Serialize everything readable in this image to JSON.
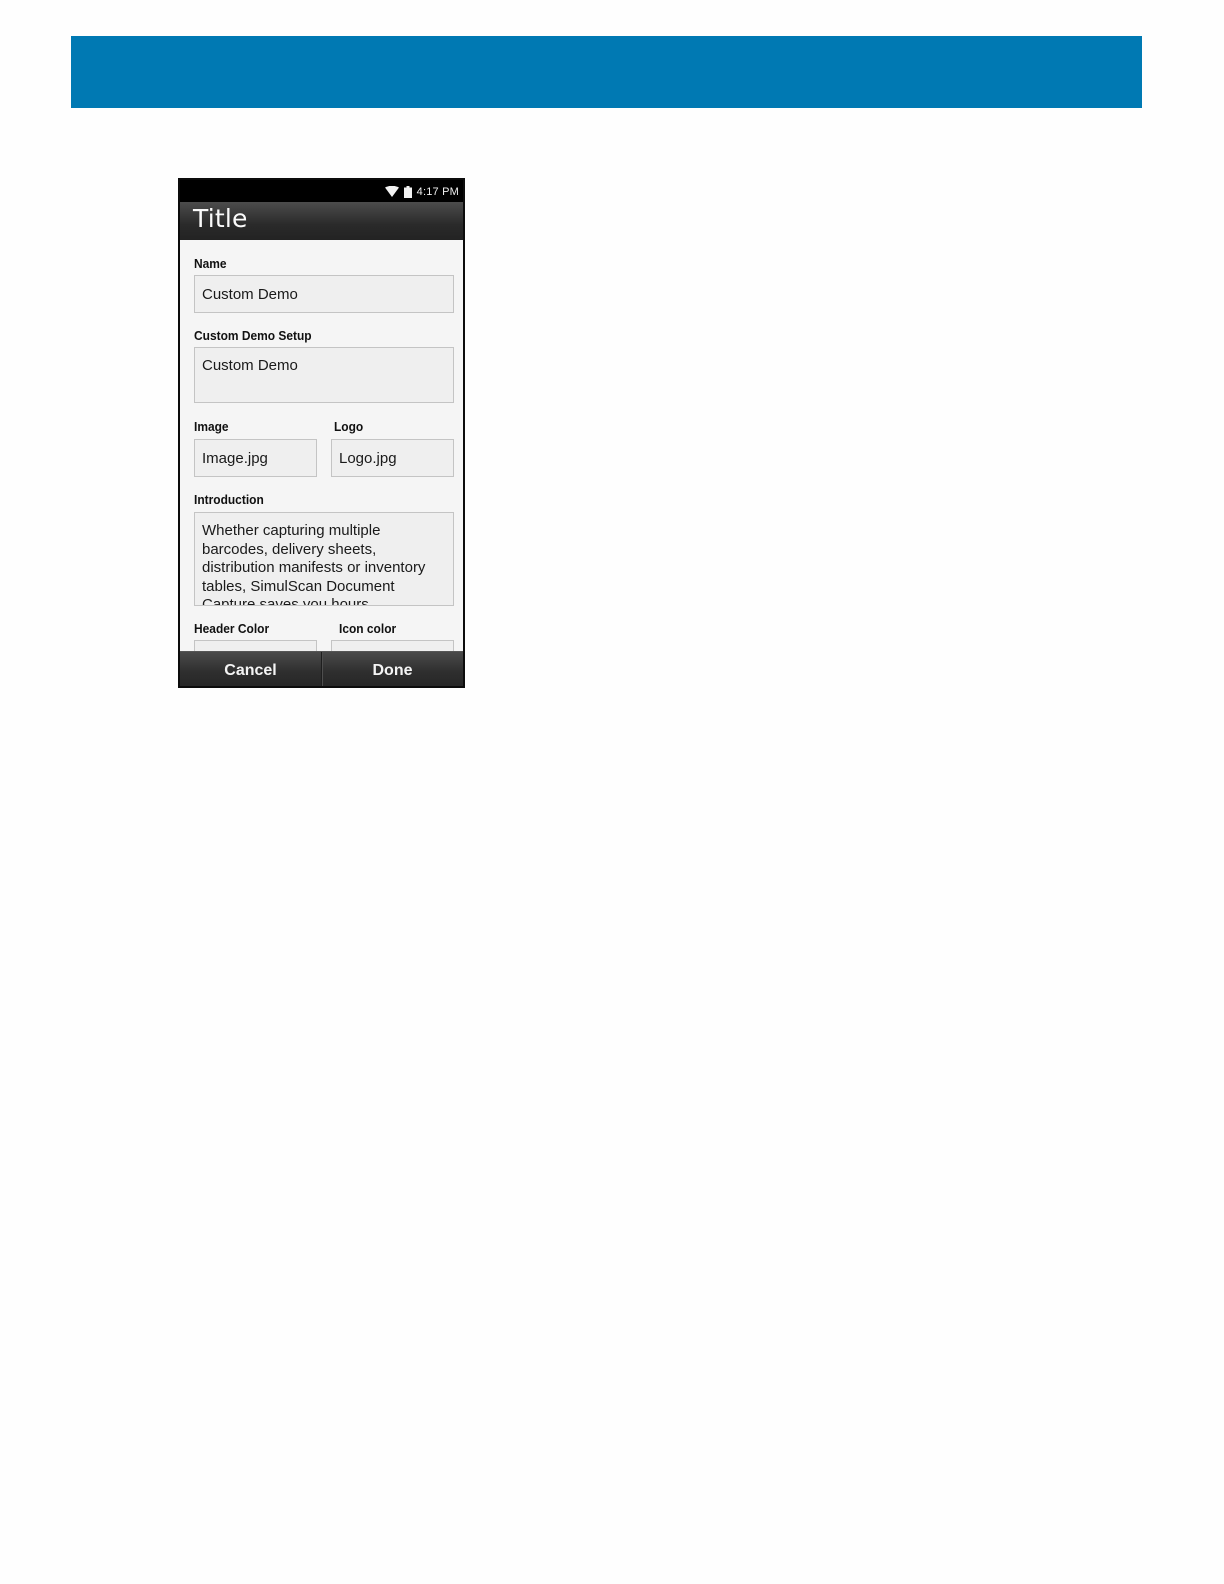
{
  "status_bar": {
    "time": "4:17 PM",
    "icons": [
      "wifi-icon",
      "battery-icon"
    ]
  },
  "action_bar": {
    "title": "Title"
  },
  "form": {
    "name": {
      "label": "Name",
      "value": "Custom Demo"
    },
    "setup": {
      "label": "Custom Demo Setup",
      "value": "Custom Demo"
    },
    "image": {
      "label": "Image",
      "value": "Image.jpg"
    },
    "logo": {
      "label": "Logo",
      "value": "Logo.jpg"
    },
    "introduction": {
      "label": "Introduction",
      "value": "Whether capturing multiple barcodes, delivery sheets, distribution manifests or inventory tables, SimulScan Document Capture saves you hours."
    },
    "header_color": {
      "label": "Header Color",
      "value": ""
    },
    "icon_color": {
      "label": "Icon color",
      "value": ""
    }
  },
  "bottom_bar": {
    "cancel_label": "Cancel",
    "done_label": "Done"
  },
  "colors": {
    "doc_header_band": "#0079b3",
    "action_bar": "#2a2a2a",
    "content_background": "#f5f5f5",
    "field_background": "#efefef"
  }
}
